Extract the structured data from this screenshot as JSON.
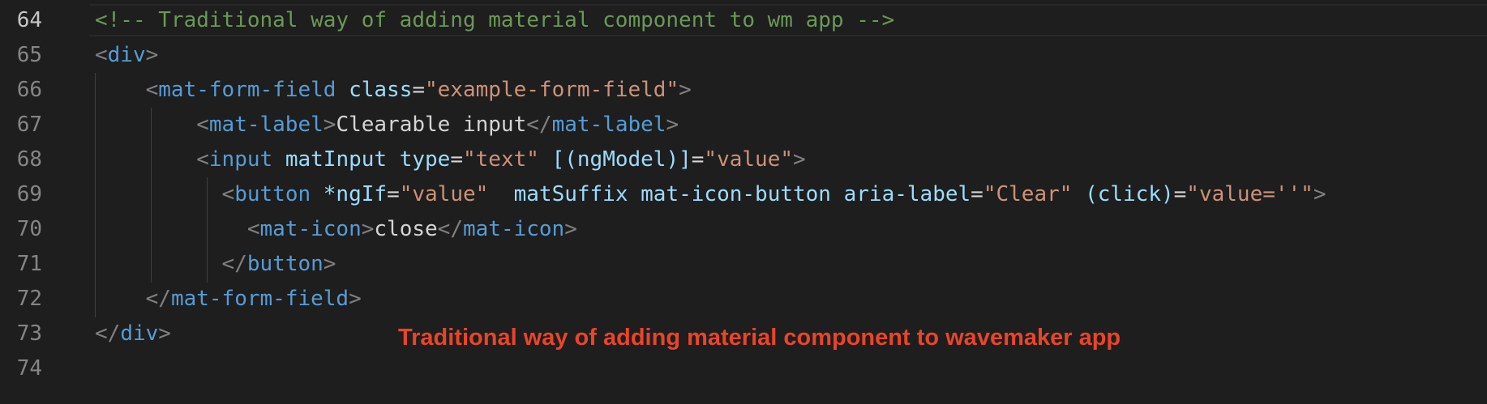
{
  "editor": {
    "active_line": "64",
    "annotation": "Traditional way of adding material component to wavemaker app",
    "colors": {
      "background": "#1e1e1e",
      "comment": "#6a9955",
      "tag": "#569cd6",
      "attribute": "#9cdcfe",
      "string": "#ce9178",
      "annotation": "#e8452a"
    },
    "lines": [
      {
        "number": "64",
        "tokens": [
          {
            "t": "comment",
            "v": "<!-- Traditional way of adding material component to wm app -->"
          }
        ]
      },
      {
        "number": "65",
        "tokens": [
          {
            "t": "punct",
            "v": "<"
          },
          {
            "t": "tag",
            "v": "div"
          },
          {
            "t": "punct",
            "v": ">"
          }
        ]
      },
      {
        "number": "66",
        "tokens": [
          {
            "t": "text",
            "v": "    "
          },
          {
            "t": "punct",
            "v": "<"
          },
          {
            "t": "tag",
            "v": "mat-form-field"
          },
          {
            "t": "text",
            "v": " "
          },
          {
            "t": "attr",
            "v": "class"
          },
          {
            "t": "eq",
            "v": "="
          },
          {
            "t": "str",
            "v": "\"example-form-field\""
          },
          {
            "t": "punct",
            "v": ">"
          }
        ]
      },
      {
        "number": "67",
        "tokens": [
          {
            "t": "text",
            "v": "        "
          },
          {
            "t": "punct",
            "v": "<"
          },
          {
            "t": "tag",
            "v": "mat-label"
          },
          {
            "t": "punct",
            "v": ">"
          },
          {
            "t": "text",
            "v": "Clearable input"
          },
          {
            "t": "punct",
            "v": "</"
          },
          {
            "t": "tag",
            "v": "mat-label"
          },
          {
            "t": "punct",
            "v": ">"
          }
        ]
      },
      {
        "number": "68",
        "tokens": [
          {
            "t": "text",
            "v": "        "
          },
          {
            "t": "punct",
            "v": "<"
          },
          {
            "t": "tag",
            "v": "input"
          },
          {
            "t": "text",
            "v": " "
          },
          {
            "t": "attr",
            "v": "matInput"
          },
          {
            "t": "text",
            "v": " "
          },
          {
            "t": "attr",
            "v": "type"
          },
          {
            "t": "eq",
            "v": "="
          },
          {
            "t": "str",
            "v": "\"text\""
          },
          {
            "t": "text",
            "v": " "
          },
          {
            "t": "attr",
            "v": "[(ngModel)]"
          },
          {
            "t": "eq",
            "v": "="
          },
          {
            "t": "str",
            "v": "\"value\""
          },
          {
            "t": "punct",
            "v": ">"
          }
        ]
      },
      {
        "number": "69",
        "tokens": [
          {
            "t": "text",
            "v": "          "
          },
          {
            "t": "punct",
            "v": "<"
          },
          {
            "t": "tag",
            "v": "button"
          },
          {
            "t": "text",
            "v": " "
          },
          {
            "t": "attr",
            "v": "*ngIf"
          },
          {
            "t": "eq",
            "v": "="
          },
          {
            "t": "str",
            "v": "\"value\""
          },
          {
            "t": "text",
            "v": "  "
          },
          {
            "t": "attr",
            "v": "matSuffix"
          },
          {
            "t": "text",
            "v": " "
          },
          {
            "t": "attr",
            "v": "mat-icon-button"
          },
          {
            "t": "text",
            "v": " "
          },
          {
            "t": "attr",
            "v": "aria-label"
          },
          {
            "t": "eq",
            "v": "="
          },
          {
            "t": "str",
            "v": "\"Clear\""
          },
          {
            "t": "text",
            "v": " "
          },
          {
            "t": "attr",
            "v": "(click)"
          },
          {
            "t": "eq",
            "v": "="
          },
          {
            "t": "str",
            "v": "\"value=''\""
          },
          {
            "t": "punct",
            "v": ">"
          }
        ]
      },
      {
        "number": "70",
        "tokens": [
          {
            "t": "text",
            "v": "            "
          },
          {
            "t": "punct",
            "v": "<"
          },
          {
            "t": "tag",
            "v": "mat-icon"
          },
          {
            "t": "punct",
            "v": ">"
          },
          {
            "t": "text",
            "v": "close"
          },
          {
            "t": "punct",
            "v": "</"
          },
          {
            "t": "tag",
            "v": "mat-icon"
          },
          {
            "t": "punct",
            "v": ">"
          }
        ]
      },
      {
        "number": "71",
        "tokens": [
          {
            "t": "text",
            "v": "          "
          },
          {
            "t": "punct",
            "v": "</"
          },
          {
            "t": "tag",
            "v": "button"
          },
          {
            "t": "punct",
            "v": ">"
          }
        ]
      },
      {
        "number": "72",
        "tokens": [
          {
            "t": "text",
            "v": "    "
          },
          {
            "t": "punct",
            "v": "</"
          },
          {
            "t": "tag",
            "v": "mat-form-field"
          },
          {
            "t": "punct",
            "v": ">"
          }
        ]
      },
      {
        "number": "73",
        "tokens": [
          {
            "t": "punct",
            "v": "</"
          },
          {
            "t": "tag",
            "v": "div"
          },
          {
            "t": "punct",
            "v": ">"
          }
        ]
      },
      {
        "number": "74",
        "tokens": []
      }
    ]
  }
}
